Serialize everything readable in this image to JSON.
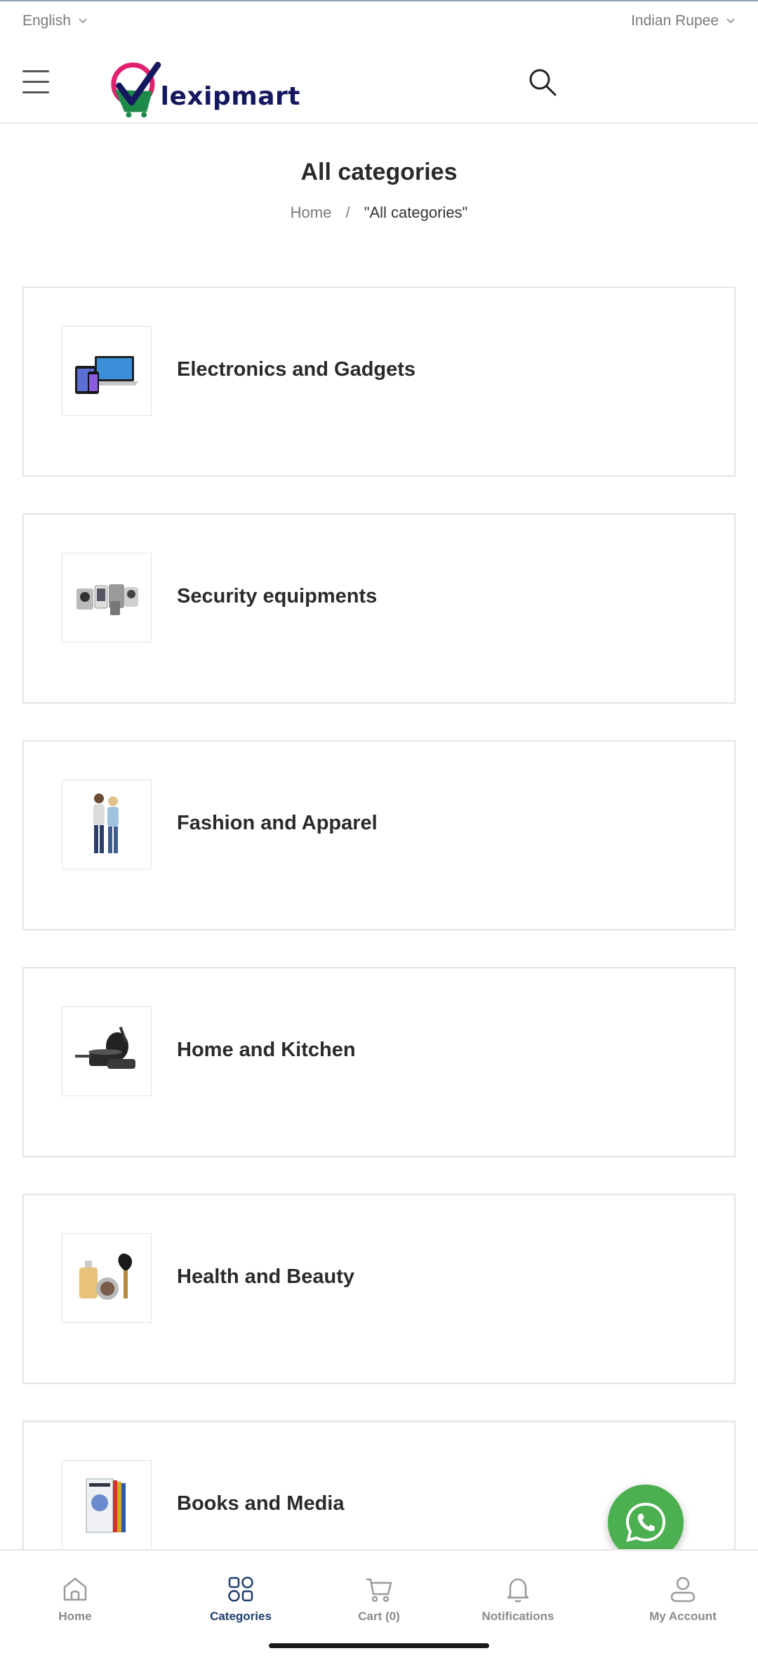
{
  "top_bar": {
    "language": "English",
    "currency": "Indian Rupee"
  },
  "header": {
    "logo_text": "lexipmart"
  },
  "page": {
    "title": "All categories",
    "breadcrumb": {
      "home": "Home",
      "separator": "/",
      "current": "\"All categories\""
    }
  },
  "categories": [
    {
      "label": "Electronics and Gadgets",
      "icon": "electronics-image"
    },
    {
      "label": "Security equipments",
      "icon": "security-image"
    },
    {
      "label": "Fashion and Apparel",
      "icon": "fashion-image"
    },
    {
      "label": "Home and Kitchen",
      "icon": "kitchen-image"
    },
    {
      "label": "Health and Beauty",
      "icon": "beauty-image"
    },
    {
      "label": "Books and Media",
      "icon": "books-image"
    }
  ],
  "bottom_nav": {
    "items": [
      {
        "label": "Home",
        "icon": "home-icon"
      },
      {
        "label": "Categories",
        "icon": "categories-icon",
        "active": true
      },
      {
        "label": "Cart (0)",
        "icon": "cart-icon"
      },
      {
        "label": "Notifications",
        "icon": "bell-icon"
      },
      {
        "label": "My Account",
        "icon": "user-icon"
      }
    ]
  },
  "colors": {
    "brand_navy": "#16185f",
    "brand_pink": "#e0216e",
    "brand_green": "#1e8a4a",
    "nav_active": "#1d3d6e",
    "whatsapp": "#4caf50"
  }
}
